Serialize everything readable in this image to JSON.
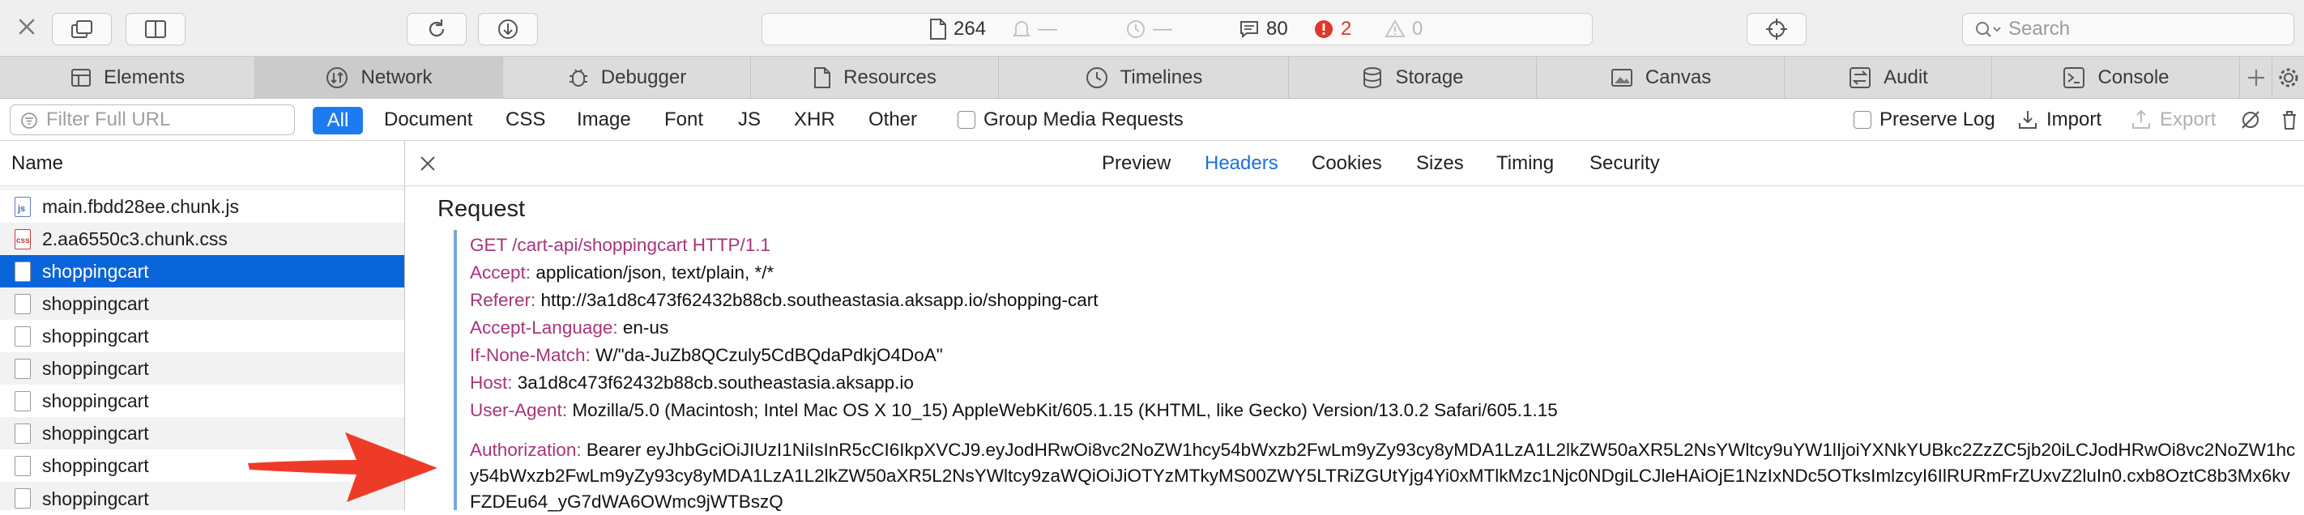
{
  "toolbar": {
    "status": {
      "resources_count": "264",
      "dash_a": "—",
      "dash_b": "—",
      "messages_count": "80",
      "errors_count": "2",
      "warnings_count": "0"
    },
    "search_placeholder": "Search"
  },
  "tabs": [
    {
      "label": "Elements",
      "icon": "elements-icon"
    },
    {
      "label": "Network",
      "icon": "network-icon"
    },
    {
      "label": "Debugger",
      "icon": "debugger-icon"
    },
    {
      "label": "Resources",
      "icon": "resources-icon"
    },
    {
      "label": "Timelines",
      "icon": "timelines-icon"
    },
    {
      "label": "Storage",
      "icon": "storage-icon"
    },
    {
      "label": "Canvas",
      "icon": "canvas-icon"
    },
    {
      "label": "Audit",
      "icon": "audit-icon"
    },
    {
      "label": "Console",
      "icon": "console-icon"
    }
  ],
  "filterbar": {
    "url_placeholder": "Filter Full URL",
    "types": [
      "All",
      "Document",
      "CSS",
      "Image",
      "Font",
      "JS",
      "XHR",
      "Other"
    ],
    "group_media": "Group Media Requests",
    "preserve_log": "Preserve Log",
    "import": "Import",
    "export": "Export"
  },
  "list": {
    "header": "Name",
    "rows": [
      {
        "name": "main.fbdd28ee.chunk.js",
        "type": "js"
      },
      {
        "name": "2.aa6550c3.chunk.css",
        "type": "css"
      },
      {
        "name": "shoppingcart",
        "type": "doc"
      },
      {
        "name": "shoppingcart",
        "type": "doc"
      },
      {
        "name": "shoppingcart",
        "type": "doc"
      },
      {
        "name": "shoppingcart",
        "type": "doc"
      },
      {
        "name": "shoppingcart",
        "type": "doc"
      },
      {
        "name": "shoppingcart",
        "type": "doc"
      },
      {
        "name": "shoppingcart",
        "type": "doc"
      },
      {
        "name": "shoppingcart",
        "type": "doc"
      }
    ]
  },
  "detail": {
    "subtabs": [
      "Preview",
      "Headers",
      "Cookies",
      "Sizes",
      "Timing",
      "Security"
    ],
    "active_subtab": "Headers",
    "section_title": "Request",
    "request_line": "GET /cart-api/shoppingcart HTTP/1.1",
    "headers": [
      {
        "key": "Accept:",
        "value": "application/json, text/plain, */*"
      },
      {
        "key": "Referer:",
        "value": "http://3a1d8c473f62432b88cb.southeastasia.aksapp.io/shopping-cart"
      },
      {
        "key": "Accept-Language:",
        "value": "en-us"
      },
      {
        "key": "If-None-Match:",
        "value": "W/\"da-JuZb8QCzuly5CdBQdaPdkjO4DoA\""
      },
      {
        "key": "Host:",
        "value": "3a1d8c473f62432b88cb.southeastasia.aksapp.io"
      },
      {
        "key": "User-Agent:",
        "value": "Mozilla/5.0 (Macintosh; Intel Mac OS X 10_15) AppleWebKit/605.1.15 (KHTML, like Gecko) Version/13.0.2 Safari/605.1.15"
      }
    ],
    "authorization": {
      "key": "Authorization:",
      "value": "Bearer eyJhbGciOiJIUzI1NiIsInR5cCI6IkpXVCJ9.eyJodHRwOi8vc2NoZW1hcy54bWxzb2FwLm9yZy93cy8yMDA1LzA1L2lkZW50aXR5L2NsYWltcy9uYW1lIjoiYXNkYUBkc2ZzZC5jb20iLCJodHRwOi8vc2NoZW1hcy54bWxzb2FwLm9yZy93cy8yMDA1LzA1L2lkZW50aXR5L2NsYWltcy9zaWQiOiJiOTYzMTkyMS00ZWY5LTRiZGUtYjg4Yi0xMTlkMzc1Njc0NDgiLCJleHAiOjE1NzIxNDc5OTksImlzcyI6IlRURmFrZUxvZ2luIn0.cxb8OztC8b3Mx6kvFZDEu64_yG7dWA6OWmc9jWTBszQ"
    }
  },
  "colors": {
    "accent": "#1d7bf2",
    "selected_row": "#0a64d9",
    "header_key": "#a6357b",
    "error": "#e0352b",
    "arrow": "#ee3b28"
  }
}
